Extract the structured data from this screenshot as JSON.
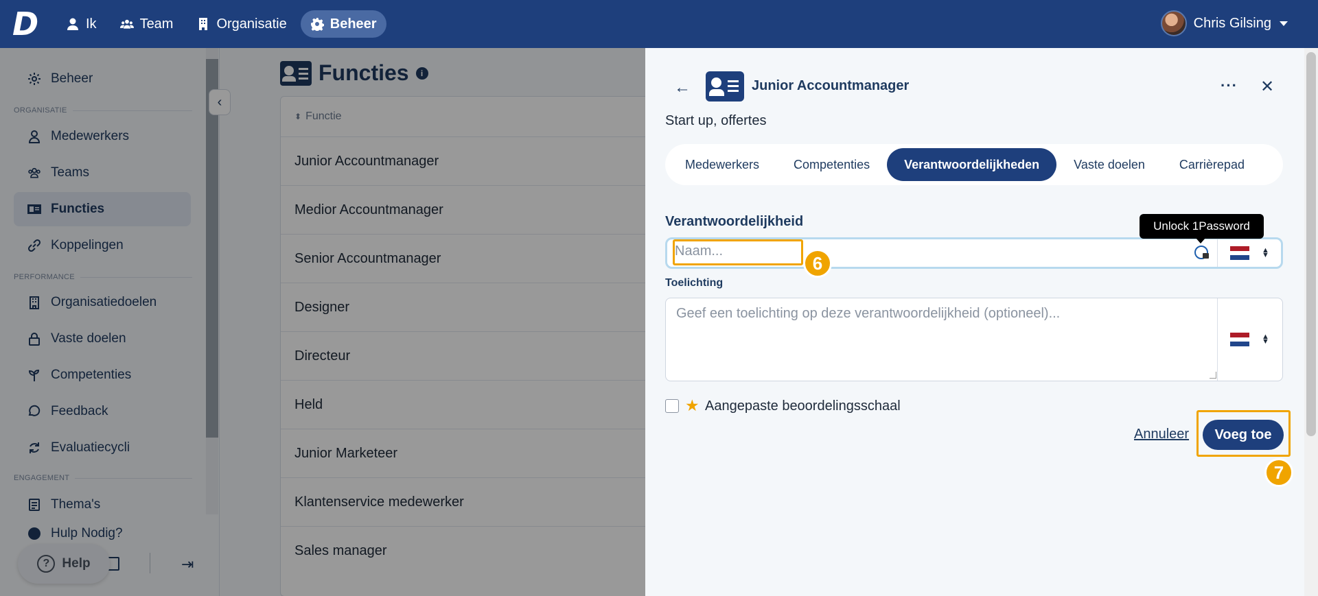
{
  "topbar": {
    "logo": "D",
    "nav": [
      {
        "label": "Ik",
        "icon": "user-icon"
      },
      {
        "label": "Team",
        "icon": "users-icon"
      },
      {
        "label": "Organisatie",
        "icon": "building-icon"
      },
      {
        "label": "Beheer",
        "icon": "gear-icon",
        "active": true
      }
    ],
    "user_name": "Chris Gilsing"
  },
  "sidebar": {
    "top_item": "Beheer",
    "section_organisatie": "ORGANISATIE",
    "organisatie_items": [
      "Medewerkers",
      "Teams",
      "Functies",
      "Koppelingen"
    ],
    "section_performance": "PERFORMANCE",
    "performance_items": [
      "Organisatiedoelen",
      "Vaste doelen",
      "Competenties",
      "Feedback",
      "Evaluatiecycli"
    ],
    "section_engagement": "ENGAGEMENT",
    "engagement_items": [
      "Thema's",
      "Hulp Nodig?"
    ],
    "help_label": "Help"
  },
  "main": {
    "title": "Functies",
    "column_header": "Functie",
    "rows": [
      "Junior Accountmanager",
      "Medior Accountmanager",
      "Senior Accountmanager",
      "Designer",
      "Directeur",
      "Held",
      "Junior Marketeer",
      "Klantenservice medewerker",
      "Sales manager"
    ]
  },
  "panel": {
    "title": "Junior Accountmanager",
    "subtitle": "Start up, offertes",
    "more": "···",
    "close": "✕",
    "tabs": [
      "Medewerkers",
      "Competenties",
      "Verantwoordelijkheden",
      "Vaste doelen",
      "Carrièrepad"
    ],
    "active_tab": "Verantwoordelijkheden",
    "field_label": "Verantwoordelijkheid",
    "name_placeholder": "Naam...",
    "tooltip": "Unlock 1Password",
    "desc_label": "Toelichting",
    "desc_placeholder": "Geef een toelichting op deze verantwoordelijkheid (optioneel)...",
    "checkbox_label": "Aangepaste beoordelingsschaal",
    "cancel_label": "Annuleer",
    "add_label": "Voeg toe",
    "step_badges": [
      "6",
      "7"
    ]
  },
  "colors": {
    "primary": "#1e3f7c",
    "highlight": "#f0a400",
    "flag_red": "#ae1c28",
    "flag_blue": "#21468b"
  }
}
